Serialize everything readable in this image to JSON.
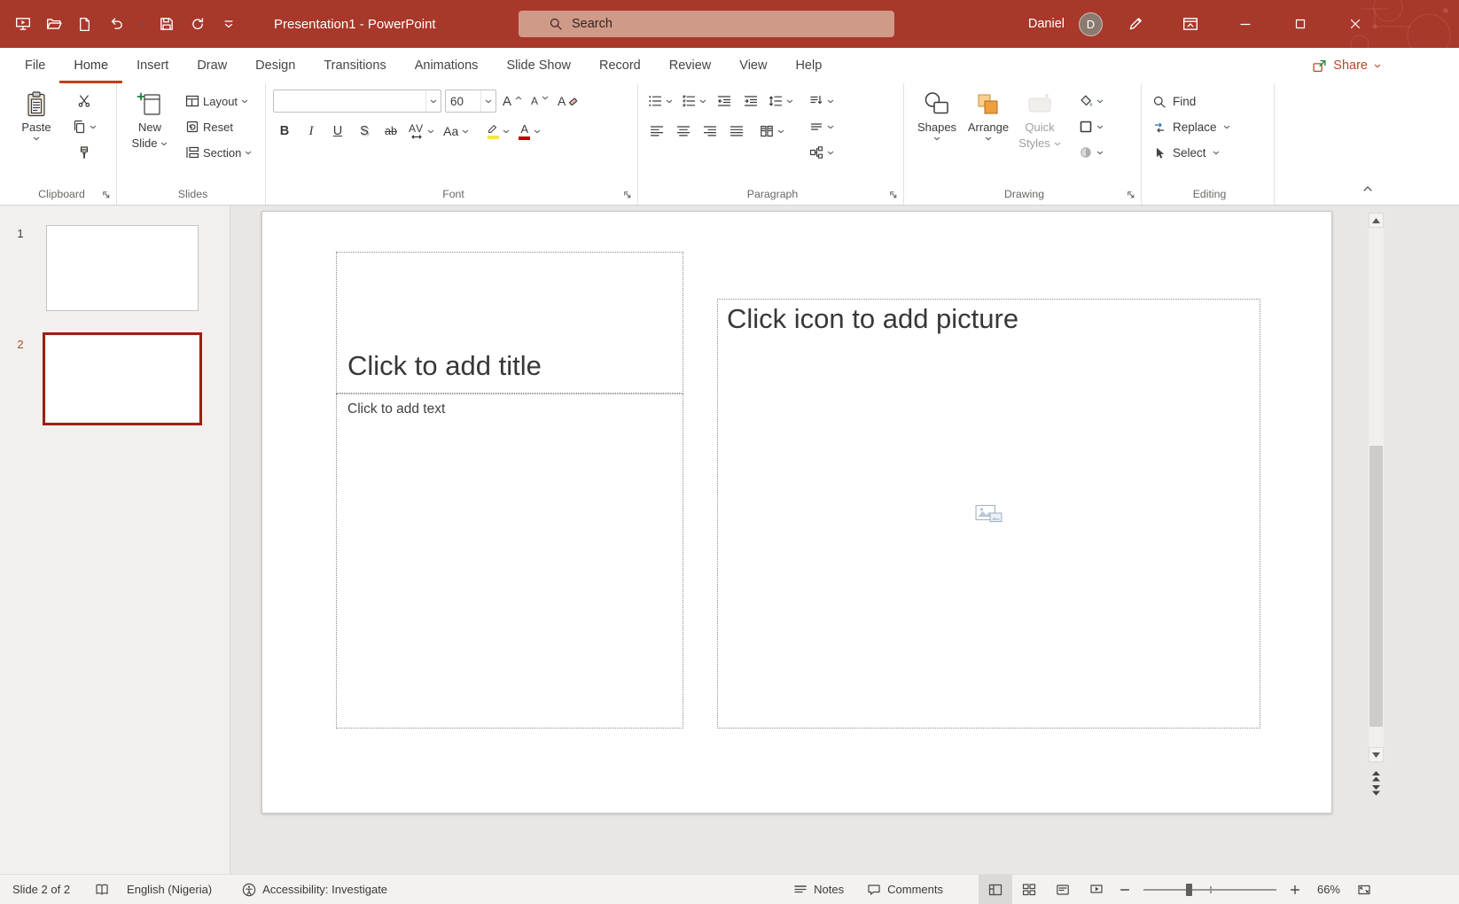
{
  "window": {
    "title": "Presentation1  -  PowerPoint",
    "search_placeholder": "Search",
    "user_name": "Daniel",
    "avatar_initial": "D"
  },
  "tabs": {
    "items": [
      "File",
      "Home",
      "Insert",
      "Draw",
      "Design",
      "Transitions",
      "Animations",
      "Slide Show",
      "Record",
      "Review",
      "View",
      "Help"
    ],
    "active": "Home",
    "share_label": "Share"
  },
  "ribbon": {
    "clipboard": {
      "label": "Clipboard",
      "paste": "Paste"
    },
    "slides": {
      "label": "Slides",
      "new_slide_1": "New",
      "new_slide_2": "Slide",
      "layout": "Layout",
      "reset": "Reset",
      "section": "Section"
    },
    "font": {
      "label": "Font",
      "size_value": "60",
      "bold": "B",
      "italic": "I",
      "underline": "U",
      "shadow": "S",
      "strikethrough": "ab",
      "char_spacing": "AV",
      "change_case": "Aa",
      "grow_letter": "A",
      "shrink_letter": "A",
      "clear_letter": "A",
      "font_color_letter": "A"
    },
    "paragraph": {
      "label": "Paragraph"
    },
    "drawing": {
      "label": "Drawing",
      "shapes": "Shapes",
      "arrange": "Arrange",
      "quick_styles_1": "Quick",
      "quick_styles_2": "Styles"
    },
    "editing": {
      "label": "Editing",
      "find": "Find",
      "replace": "Replace",
      "select": "Select"
    }
  },
  "slide_panel": {
    "slides": [
      {
        "number": "1"
      },
      {
        "number": "2"
      }
    ]
  },
  "slide": {
    "title_placeholder": "Click to add title",
    "body_placeholder": "Click to add text",
    "picture_placeholder": "Click icon to add picture"
  },
  "status": {
    "slide_indicator": "Slide 2 of 2",
    "language": "English (Nigeria)",
    "accessibility": "Accessibility: Investigate",
    "notes": "Notes",
    "comments": "Comments",
    "zoom_value": "66%"
  },
  "colors": {
    "titlebar_red": "#a8382a",
    "accent_red": "#b7472a",
    "home_tab_underline": "#c43e1c",
    "selected_slide_border": "#9a2013",
    "search_box": "#d09a89",
    "new_slide_plus_green": "#1a7f3c",
    "arrange_orange": "#ee9f3d",
    "highlight_yellow": "#f5e34d",
    "font_color_red": "#c00000"
  }
}
